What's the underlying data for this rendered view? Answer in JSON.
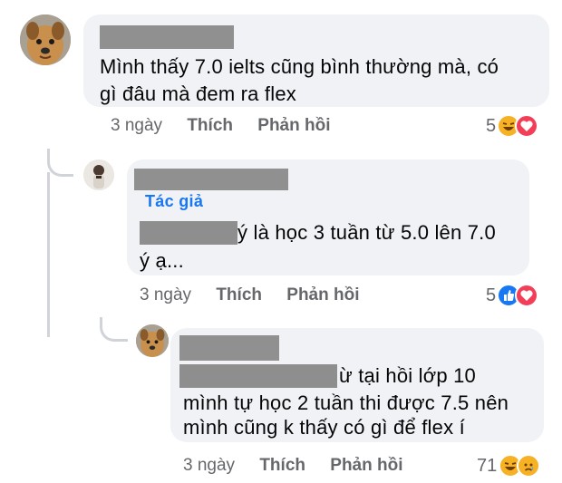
{
  "colors": {
    "bubble": "#f0f2f5",
    "author_blue": "#1877f2",
    "meta_gray": "#65676b",
    "like_blue": "#1877f2",
    "love_red": "#f33e58",
    "haha_yellow": "#f7b125"
  },
  "comments": [
    {
      "text_line1": "Mình thấy 7.0 ielts cũng bình thường mà, có",
      "text_line2": "gì đâu mà đem ra flex",
      "time": "3 ngày",
      "like_label": "Thích",
      "reply_label": "Phản hồi",
      "reaction_count": "5",
      "reactions": [
        "haha-icon",
        "love-icon"
      ]
    },
    {
      "author_badge": "Tác giả",
      "text_line1": "ý là học 3 tuần từ 5.0 lên 7.0",
      "text_line2": "ý ạ...",
      "time": "3 ngày",
      "like_label": "Thích",
      "reply_label": "Phản hồi",
      "reaction_count": "5",
      "reactions": [
        "like-icon",
        "love-icon"
      ]
    },
    {
      "text_line1": "ừ tại hồi lớp 10",
      "text_line2": "mình tự học 2 tuần thi được 7.5 nên",
      "text_line3": "mình cũng k thấy có gì để flex í",
      "time": "3 ngày",
      "like_label": "Thích",
      "reply_label": "Phản hồi",
      "reaction_count": "71",
      "reactions": [
        "haha-icon",
        "sad-icon"
      ]
    }
  ]
}
